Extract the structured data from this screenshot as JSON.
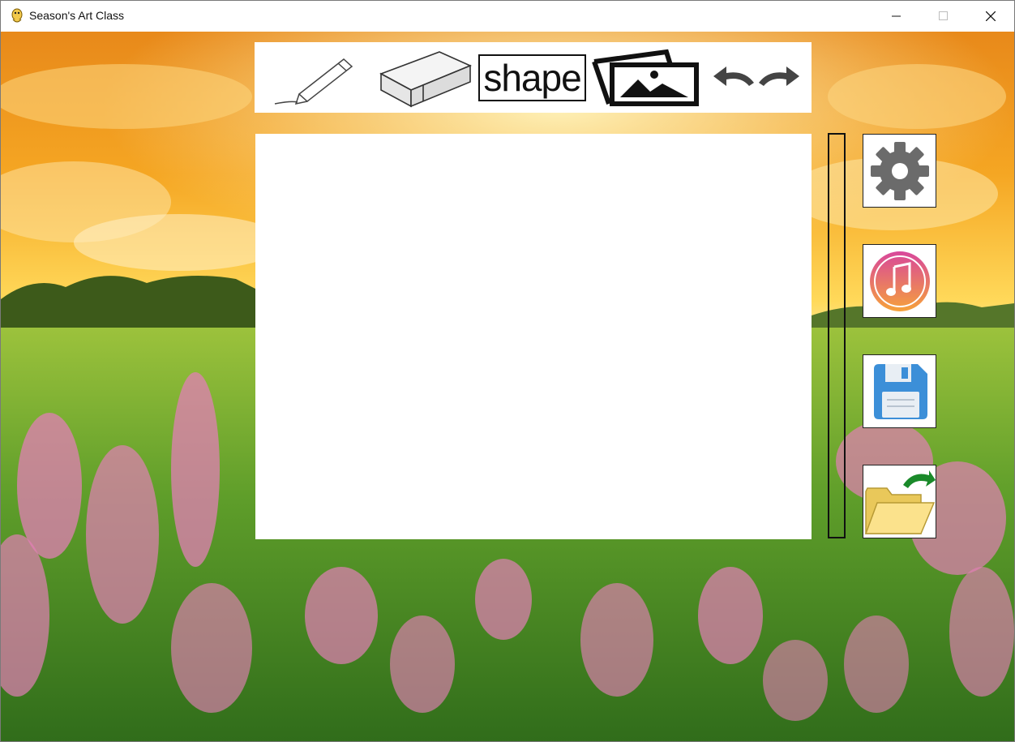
{
  "window": {
    "title": "Season's Art Class"
  },
  "toolbar": {
    "shape_label": "shape",
    "tools": [
      "pencil-icon",
      "eraser-icon",
      "shape-icon",
      "image-icon",
      "undo-redo-icon"
    ]
  },
  "sidebar": {
    "buttons": [
      "settings-icon",
      "music-icon",
      "save-icon",
      "open-folder-icon"
    ]
  },
  "colors": {
    "sky": "#f5a623",
    "grass": "#5a9a2a",
    "flowers": "#e27fb6"
  }
}
